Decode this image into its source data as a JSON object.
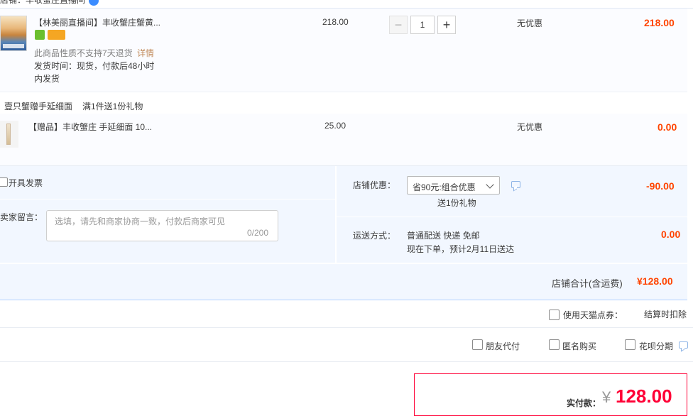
{
  "shop": {
    "header_label": "店铺：丰收蟹庄直播间"
  },
  "items": [
    {
      "title": "【林美丽直播间】丰收蟹庄蟹黄...",
      "notice": "此商品性质不支持7天退货",
      "notice_link": "详情",
      "ship_line1": "发货时间：现货，付款后48小时",
      "ship_line2": "内发货",
      "unit_price": "218.00",
      "quantity": "1",
      "promo": "无优惠",
      "subtotal": "218.00"
    },
    {
      "title": "【赠品】丰收蟹庄 手延细面 10...",
      "unit_price": "25.00",
      "promo": "无优惠",
      "subtotal": "0.00"
    }
  ],
  "gift_promo": {
    "name": "壹只蟹赠手延细面",
    "rule": "满1件送1份礼物"
  },
  "invoice": {
    "label": "开具发票"
  },
  "message": {
    "label": "给卖家留言：",
    "placeholder": "选填，请先和商家协商一致，付款后商家可见",
    "counter": "0/200"
  },
  "store_discount": {
    "label": "店铺优惠：",
    "selected": "省90元:组合优惠",
    "gift_note": "送1份礼物",
    "amount": "-90.00"
  },
  "delivery": {
    "label": "运送方式：",
    "method": "普通配送 快递 免邮",
    "eta": "现在下单，预计2月11日送达",
    "amount": "0.00"
  },
  "shop_total": {
    "label": "店铺合计(含运费)",
    "amount": "¥128.00"
  },
  "points": {
    "label": "使用天猫点券：",
    "note": "结算时扣除"
  },
  "options": {
    "friend_pay": "朋友代付",
    "anonymous": "匿名购买",
    "huabei": "花呗分期"
  },
  "payment": {
    "label": "实付款：",
    "currency": "¥",
    "amount": "128.00"
  },
  "colors": {
    "accent_red": "#ff4400",
    "pay_red": "#ff0036",
    "band_blue": "#f2f7ff",
    "border_blue": "#b2d1ff"
  },
  "icons": [
    "check-icon",
    "shield-icon",
    "card-icon",
    "minus-icon",
    "plus-icon",
    "chevron-down-icon",
    "chat-icon"
  ]
}
